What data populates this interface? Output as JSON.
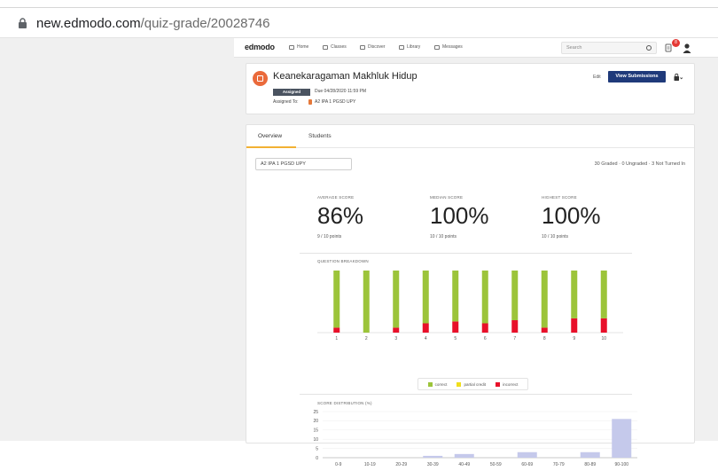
{
  "browser": {
    "url_host": "new.edmodo.com",
    "url_path": "/quiz-grade/20028746"
  },
  "nav": {
    "logo": "edmodo",
    "items": [
      {
        "label": "Home",
        "icon": "home-icon"
      },
      {
        "label": "Classes",
        "icon": "classes-icon"
      },
      {
        "label": "Discover",
        "icon": "discover-icon"
      },
      {
        "label": "Library",
        "icon": "library-icon"
      },
      {
        "label": "Messages",
        "icon": "messages-icon"
      }
    ],
    "search_placeholder": "Search",
    "notification_count": "8"
  },
  "assignment": {
    "title": "Keanekaragaman Makhluk Hidup",
    "status": "Assigned",
    "due": "Due 04/28/2020 11:59 PM",
    "assigned_to_label": "Assigned To:",
    "assigned_to": "A2 IPA 1 PGSD UPY",
    "edit_label": "Edit",
    "view_submissions_label": "View Submissions"
  },
  "tabs": [
    {
      "label": "Overview",
      "active": true
    },
    {
      "label": "Students",
      "active": false
    }
  ],
  "filter": {
    "section_value": "A2 IPA 1 PGSD UPY",
    "summary": "30 Graded · 0 Ungraded · 3 Not Turned In"
  },
  "stats": [
    {
      "label": "AVERAGE SCORE",
      "value": "86%",
      "points": "9 / 10 points"
    },
    {
      "label": "MEDIAN SCORE",
      "value": "100%",
      "points": "10 / 10 points"
    },
    {
      "label": "HIGHEST SCORE",
      "value": "100%",
      "points": "10 / 10 points"
    }
  ],
  "colors": {
    "correct": "#9cc43a",
    "partial": "#f0de1c",
    "incorrect": "#e8102a",
    "distribution": "#c5c9eb",
    "primary_button": "#1f3a7a",
    "tab_accent": "#f2b134"
  },
  "chart_data": [
    {
      "type": "bar",
      "title": "QUESTION BREAKDOWN",
      "categories": [
        "1",
        "2",
        "3",
        "4",
        "5",
        "6",
        "7",
        "8",
        "9",
        "10"
      ],
      "series": [
        {
          "name": "correct",
          "values": [
            92,
            100,
            92,
            85,
            82,
            85,
            80,
            92,
            77,
            77
          ]
        },
        {
          "name": "partial credit",
          "values": [
            0,
            0,
            0,
            0,
            0,
            0,
            0,
            0,
            0,
            0
          ]
        },
        {
          "name": "incorrect",
          "values": [
            8,
            0,
            8,
            15,
            18,
            15,
            20,
            8,
            23,
            23
          ]
        }
      ],
      "stacked": true,
      "legend_position": "bottom"
    },
    {
      "type": "bar",
      "title": "SCORE DISTRIBUTION (%)",
      "categories": [
        "0-9",
        "10-19",
        "20-29",
        "30-39",
        "40-49",
        "50-59",
        "60-69",
        "70-79",
        "80-89",
        "90-100"
      ],
      "values": [
        0,
        0,
        0,
        1,
        2,
        0,
        3,
        0,
        3,
        21
      ],
      "ylim": [
        0,
        25
      ],
      "yticks": [
        "0",
        "5",
        "10",
        "15",
        "20",
        "25"
      ]
    }
  ]
}
